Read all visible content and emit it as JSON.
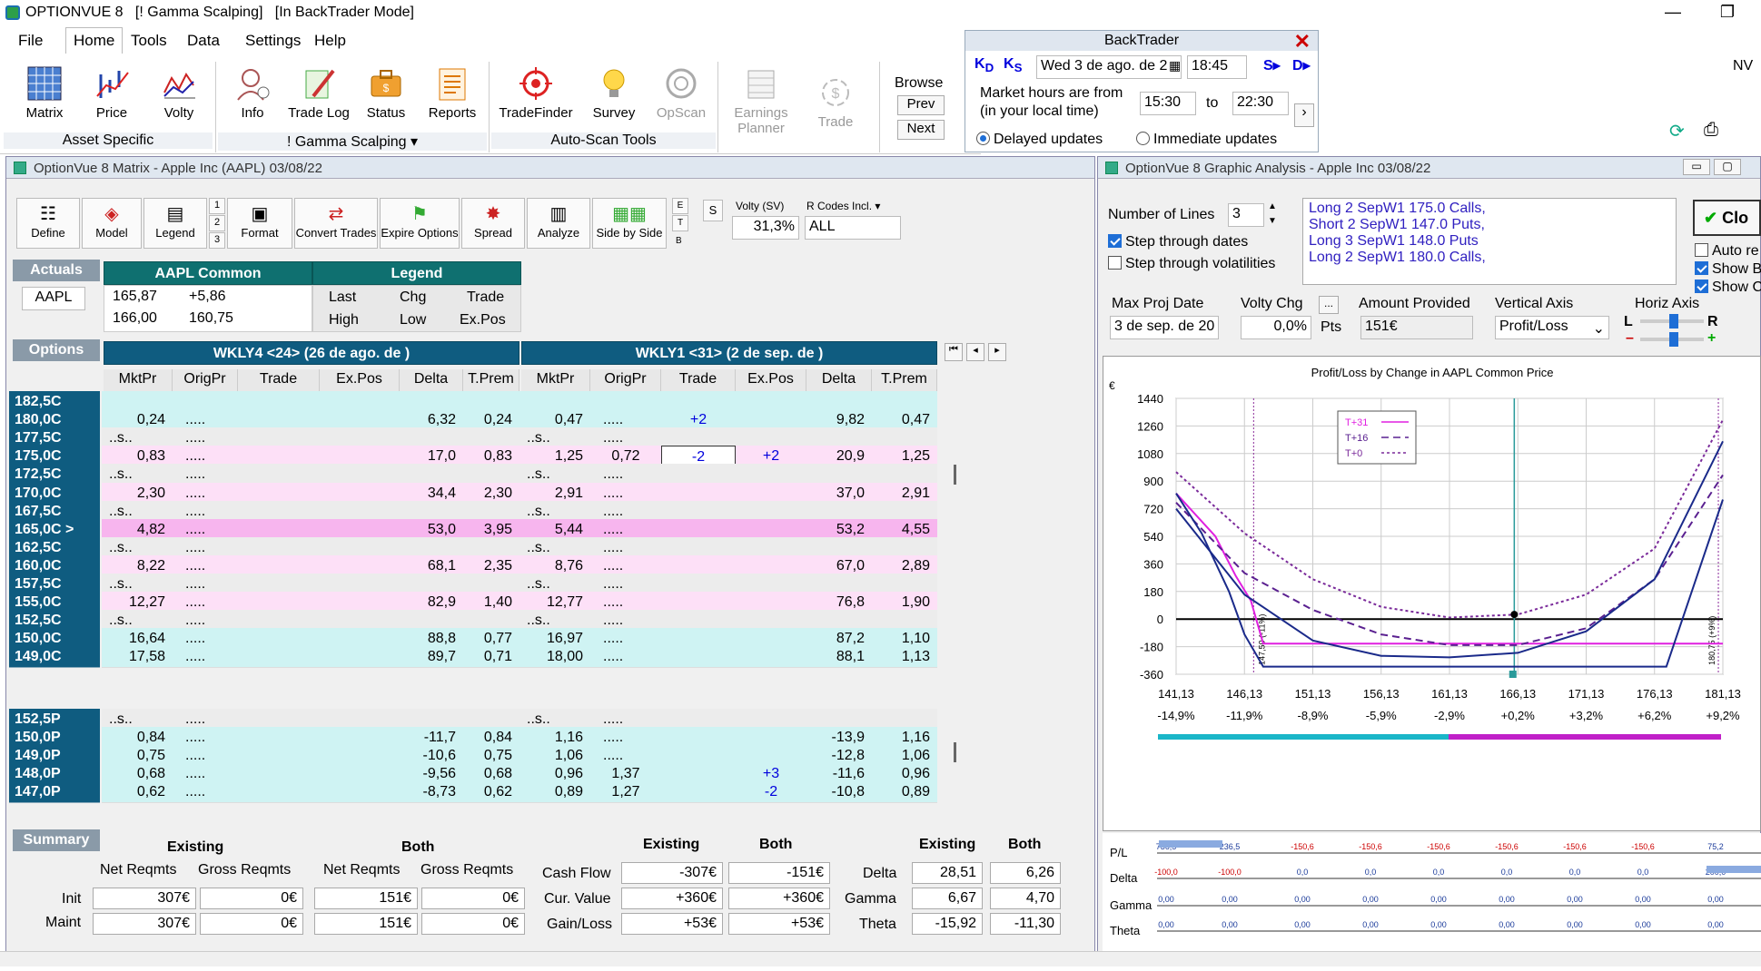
{
  "app": {
    "title": "OPTIONVUE 8   [! Gamma Scalping]   [In BackTrader Mode]",
    "min": "—",
    "max": "❐"
  },
  "menu": {
    "file": "File",
    "home": "Home",
    "tools": "Tools",
    "data": "Data",
    "settings": "Settings",
    "help": "Help"
  },
  "ribbon": {
    "matrix": "Matrix",
    "price": "Price",
    "volty": "Volty",
    "info": "Info",
    "trade_log": "Trade Log",
    "status": "Status",
    "reports": "Reports",
    "tradefinder": "TradeFinder",
    "survey": "Survey",
    "opscan": "OpScan",
    "earnings1": "Earnings",
    "earnings2": "Planner",
    "trade": "Trade",
    "browse": "Browse",
    "prev": "Prev",
    "next": "Next",
    "grp_asset": "Asset Specific",
    "grp_gamma": "! Gamma Scalping ▾",
    "grp_autoscan": "Auto-Scan Tools"
  },
  "backtrader": {
    "title": "BackTrader",
    "date": "Wed 3 de ago. de 2",
    "time": "18:45",
    "kd": "K",
    "kd_sub": "D",
    "ks": "K",
    "ks_sub": "S",
    "sm": "S",
    "dm": "D",
    "market_hours1": "Market hours are from",
    "market_hours2": "(in your local time)",
    "from": "15:30",
    "to_label": "to",
    "to": "22:30",
    "delayed": "Delayed updates",
    "immediate": "Immediate updates"
  },
  "nv": "NV",
  "matrix": {
    "title": "OptionVue 8 Matrix - Apple Inc (AAPL)  03/08/22",
    "toolbar": {
      "define": "Define",
      "model": "Model",
      "legend": "Legend",
      "format": "Format",
      "convert": "Convert Trades",
      "expire": "Expire Options",
      "spread": "Spread",
      "analyze": "Analyze",
      "sidebyside": "Side by Side",
      "n1": "1",
      "n2": "2",
      "n3": "3",
      "e": "E",
      "t": "T",
      "b": "B",
      "s": "S",
      "volty_label": "Volty (SV)",
      "volty_val": "31,3%",
      "rcodes_label": "R Codes Incl.",
      "rcodes_val": "ALL"
    },
    "actuals": {
      "label": "Actuals",
      "symbol": "AAPL",
      "common_hdr": "AAPL Common",
      "legend_hdr": "Legend",
      "v1": "165,87",
      "v2": "+5,86",
      "v3": "166,00",
      "v4": "160,75",
      "last": "Last",
      "chg": "Chg",
      "trade": "Trade",
      "high": "High",
      "low": "Low",
      "expos": "Ex.Pos"
    },
    "options_label": "Options",
    "series1": "WKLY4 <24> (26 de ago. de )",
    "series2": "WKLY1 <31> (2 de sep. de )",
    "cols": [
      "MktPr",
      "OrigPr",
      "Trade",
      "Ex.Pos",
      "Delta",
      "T.Prem",
      "MktPr",
      "OrigPr",
      "Trade",
      "Ex.Pos",
      "Delta",
      "T.Prem"
    ],
    "rows": [
      {
        "s": "182,5C",
        "c": [
          "",
          "",
          "",
          "",
          "",
          "",
          "",
          "",
          "",
          "",
          "",
          ""
        ],
        "bg": "#cff3f3"
      },
      {
        "s": "180,0C",
        "c": [
          "0,24",
          ".....",
          "",
          "",
          "6,32",
          "0,24",
          "0,47",
          ".....",
          "+2",
          "",
          "9,82",
          "0,47"
        ],
        "bg": "#cff3f3"
      },
      {
        "s": "177,5C",
        "c": [
          "..s..",
          ".....",
          "",
          "",
          "",
          "",
          "..s..",
          ".....",
          "",
          "",
          "",
          ""
        ],
        "bg": "#ececec"
      },
      {
        "s": "175,0C",
        "c": [
          "0,83",
          ".....",
          "",
          "",
          "17,0",
          "0,83",
          "1,25",
          "0,72",
          "-2",
          "+2",
          "20,9",
          "1,25"
        ],
        "bg": "#fde0f7"
      },
      {
        "s": "172,5C",
        "c": [
          "..s..",
          ".....",
          "",
          "",
          "",
          "",
          "..s..",
          ".....",
          "",
          "",
          "",
          ""
        ],
        "bg": "#ececec"
      },
      {
        "s": "170,0C",
        "c": [
          "2,30",
          ".....",
          "",
          "",
          "34,4",
          "2,30",
          "2,91",
          ".....",
          "",
          "",
          "37,0",
          "2,91"
        ],
        "bg": "#fde0f7"
      },
      {
        "s": "167,5C",
        "c": [
          "..s..",
          ".....",
          "",
          "",
          "",
          "",
          "..s..",
          ".....",
          "",
          "",
          "",
          ""
        ],
        "bg": "#ececec"
      },
      {
        "s": "165,0C >",
        "c": [
          "4,82",
          ".....",
          "",
          "",
          "53,0",
          "3,95",
          "5,44",
          ".....",
          "",
          "",
          "53,2",
          "4,55"
        ],
        "bg": "#f7b5ee"
      },
      {
        "s": "162,5C",
        "c": [
          "..s..",
          ".....",
          "",
          "",
          "",
          "",
          "..s..",
          ".....",
          "",
          "",
          "",
          ""
        ],
        "bg": "#ececec"
      },
      {
        "s": "160,0C",
        "c": [
          "8,22",
          ".....",
          "",
          "",
          "68,1",
          "2,35",
          "8,76",
          ".....",
          "",
          "",
          "67,0",
          "2,89"
        ],
        "bg": "#fde0f7"
      },
      {
        "s": "157,5C",
        "c": [
          "..s..",
          ".....",
          "",
          "",
          "",
          "",
          "..s..",
          ".....",
          "",
          "",
          "",
          ""
        ],
        "bg": "#ececec"
      },
      {
        "s": "155,0C",
        "c": [
          "12,27",
          ".....",
          "",
          "",
          "82,9",
          "1,40",
          "12,77",
          ".....",
          "",
          "",
          "76,8",
          "1,90"
        ],
        "bg": "#fde0f7"
      },
      {
        "s": "152,5C",
        "c": [
          "..s..",
          ".....",
          "",
          "",
          "",
          "",
          "..s..",
          ".....",
          "",
          "",
          "",
          ""
        ],
        "bg": "#ececec"
      },
      {
        "s": "150,0C",
        "c": [
          "16,64",
          ".....",
          "",
          "",
          "88,8",
          "0,77",
          "16,97",
          ".....",
          "",
          "",
          "87,2",
          "1,10"
        ],
        "bg": "#cff3f3"
      },
      {
        "s": "149,0C",
        "c": [
          "17,58",
          ".....",
          "",
          "",
          "89,7",
          "0,71",
          "18,00",
          ".....",
          "",
          "",
          "88,1",
          "1,13"
        ],
        "bg": "#cff3f3"
      }
    ],
    "prows": [
      {
        "s": "152,5P",
        "c": [
          "..s..",
          ".....",
          "",
          "",
          "",
          "",
          "..s..",
          ".....",
          "",
          "",
          "",
          ""
        ],
        "bg": "#ececec"
      },
      {
        "s": "150,0P",
        "c": [
          "0,84",
          ".....",
          "",
          "",
          "-11,7",
          "0,84",
          "1,16",
          ".....",
          "",
          "",
          "-13,9",
          "1,16"
        ],
        "bg": "#cff3f3"
      },
      {
        "s": "149,0P",
        "c": [
          "0,75",
          ".....",
          "",
          "",
          "-10,6",
          "0,75",
          "1,06",
          ".....",
          "",
          "",
          "-12,8",
          "1,06"
        ],
        "bg": "#cff3f3"
      },
      {
        "s": "148,0P",
        "c": [
          "0,68",
          ".....",
          "",
          "",
          "-9,56",
          "0,68",
          "0,96",
          "1,37",
          "",
          "+3",
          "-11,6",
          "0,96"
        ],
        "bg": "#cff3f3"
      },
      {
        "s": "147,0P",
        "c": [
          "0,62",
          ".....",
          "",
          "",
          "-8,73",
          "0,62",
          "0,89",
          "1,27",
          "",
          "-2",
          "-10,8",
          "0,89"
        ],
        "bg": "#cff3f3"
      }
    ],
    "summary": {
      "label": "Summary",
      "existing": "Existing",
      "both": "Both",
      "net": "Net Reqmts",
      "gross": "Gross Reqmts",
      "init": "Init",
      "maint": "Maint",
      "init_vals": [
        "307€",
        "0€",
        "151€",
        "0€"
      ],
      "maint_vals": [
        "307€",
        "0€",
        "151€",
        "0€"
      ],
      "cash_flow": "Cash Flow",
      "cur_value": "Cur. Value",
      "gain_loss": "Gain/Loss",
      "cf": [
        "-307€",
        "-151€"
      ],
      "cv": [
        "+360€",
        "+360€"
      ],
      "gl": [
        "+53€",
        "+53€"
      ],
      "delta": "Delta",
      "gamma": "Gamma",
      "theta": "Theta",
      "d": [
        "28,51",
        "6,26"
      ],
      "g": [
        "6,67",
        "4,70"
      ],
      "t": [
        "-15,92",
        "-11,30"
      ]
    }
  },
  "ga": {
    "title": "OptionVue 8 Graphic Analysis - Apple Inc  03/08/22",
    "num_lines_label": "Number of Lines",
    "num_lines": "3",
    "step_dates": "Step through dates",
    "step_vol": "Step through volatilities",
    "positions": [
      "Long 2 SepW1 175.0 Calls,",
      "Short 2 SepW1 147.0 Puts,",
      "Long 3 SepW1 148.0 Puts",
      "Long 2 SepW1 180.0 Calls,"
    ],
    "close": "Clo",
    "auto": "Auto re",
    "showb": "Show B",
    "showc": "Show C",
    "max_proj_label": "Max Proj Date",
    "max_proj": "3 de sep. de 20",
    "volty_chg_label": "Volty Chg",
    "volty_chg": "0,0%",
    "pts": "Pts",
    "dots": "...",
    "amount_label": "Amount Provided",
    "amount": "151€",
    "vert_label": "Vertical Axis",
    "vert": "Profit/Loss",
    "horiz_label": "Horiz Axis",
    "L": "L",
    "R": "R",
    "minus": "–",
    "plus": "+",
    "chart_title": "Profit/Loss by Change in AAPL Common Price",
    "euro": "€",
    "legend": [
      "T+31",
      "T+16",
      "T+0"
    ],
    "yticks": [
      "1440",
      "1260",
      "1080",
      "900",
      "720",
      "540",
      "360",
      "180",
      "0",
      "-180",
      "-360"
    ],
    "xticks": [
      "141,13",
      "146,13",
      "151,13",
      "156,13",
      "161,13",
      "166,13",
      "171,13",
      "176,13",
      "181,13"
    ],
    "xpct": [
      "-14,9%",
      "-11,9%",
      "-8,9%",
      "-5,9%",
      "-2,9%",
      "+0,2%",
      "+3,2%",
      "+6,2%",
      "+9,2%"
    ],
    "left_vlabel": "147,50 (-11%)",
    "right_vlabel": "180,75 (+9%)",
    "greeks": {
      "pl": "P/L",
      "delta": "Delta",
      "gamma": "Gamma",
      "theta": "Theta",
      "pl_vals": [
        "736,5",
        "236,5",
        "-150,6",
        "-150,6",
        "-150,6",
        "-150,6",
        "-150,6",
        "-150,6",
        "75,2"
      ],
      "delta_vals": [
        "-100,0",
        "-100,0",
        "0,0",
        "0,0",
        "0,0",
        "0,0",
        "0,0",
        "0,0",
        "200,0"
      ],
      "gamma_vals": [
        "0,00",
        "0,00",
        "0,00",
        "0,00",
        "0,00",
        "0,00",
        "0,00",
        "0,00",
        "0,00"
      ],
      "theta_vals": [
        "0,00",
        "0,00",
        "0,00",
        "0,00",
        "0,00",
        "0,00",
        "0,00",
        "0,00",
        "0,00"
      ]
    }
  },
  "chart_data": {
    "type": "line",
    "title": "Profit/Loss by Change in AAPL Common Price",
    "xlabel": "",
    "ylabel": "€",
    "xlim": [
      141.13,
      181.13
    ],
    "ylim": [
      -360,
      1440
    ],
    "series": [
      {
        "name": "T+31",
        "color": "#e020e0",
        "x": [
          141.13,
          144,
          145.5,
          146.6,
          147.5,
          148,
          181.13
        ],
        "y": [
          820,
          540,
          280,
          120,
          -160,
          -160,
          -160
        ]
      },
      {
        "name": "T+16",
        "color": "#5a2090",
        "x": [
          141.13,
          146.13,
          151.13,
          156.13,
          161.13,
          166.13,
          171.13,
          176.13,
          181.13
        ],
        "y": [
          760,
          300,
          60,
          -100,
          -170,
          -170,
          -60,
          260,
          940
        ]
      },
      {
        "name": "T+0",
        "color": "#7a2a9a",
        "x": [
          141.13,
          146.13,
          151.13,
          156.13,
          161.13,
          166.13,
          171.13,
          176.13,
          181.13
        ],
        "y": [
          960,
          560,
          260,
          80,
          10,
          30,
          160,
          460,
          1300
        ]
      },
      {
        "name": "",
        "color": "#1a2a8a",
        "x": [
          141.13,
          146.13,
          151.13,
          156.13,
          161.13,
          166.13,
          171.13,
          176.13,
          181.13
        ],
        "y": [
          720,
          160,
          -140,
          -240,
          -250,
          -220,
          -80,
          260,
          1160
        ]
      },
      {
        "name": "",
        "color": "#1a2a8a",
        "x": [
          141.13,
          143,
          145,
          146.13,
          147.5,
          148,
          177,
          181.13
        ],
        "y": [
          820,
          560,
          180,
          -100,
          -310,
          -310,
          -310,
          780
        ]
      }
    ]
  }
}
